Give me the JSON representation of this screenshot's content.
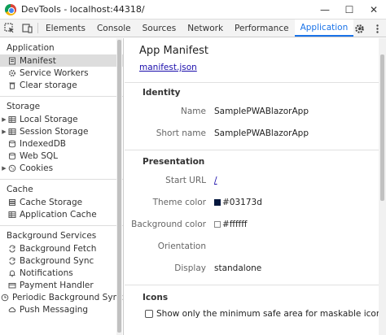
{
  "window": {
    "title": "DevTools - localhost:44318/",
    "controls": {
      "minimize": "—",
      "maximize": "☐",
      "close": "✕"
    }
  },
  "toolbar": {
    "tabs": [
      {
        "label": "Elements"
      },
      {
        "label": "Console"
      },
      {
        "label": "Sources"
      },
      {
        "label": "Network"
      },
      {
        "label": "Performance"
      },
      {
        "label": "Application"
      }
    ],
    "active_tab": "Application",
    "more_label": "»"
  },
  "sidebar": {
    "sections": {
      "application": "Application",
      "storage": "Storage",
      "cache": "Cache",
      "background_services": "Background Services"
    },
    "application_items": [
      {
        "label": "Manifest"
      },
      {
        "label": "Service Workers"
      },
      {
        "label": "Clear storage"
      }
    ],
    "storage_items": [
      {
        "label": "Local Storage"
      },
      {
        "label": "Session Storage"
      },
      {
        "label": "IndexedDB"
      },
      {
        "label": "Web SQL"
      },
      {
        "label": "Cookies"
      }
    ],
    "cache_items": [
      {
        "label": "Cache Storage"
      },
      {
        "label": "Application Cache"
      }
    ],
    "background_items": [
      {
        "label": "Background Fetch"
      },
      {
        "label": "Background Sync"
      },
      {
        "label": "Notifications"
      },
      {
        "label": "Payment Handler"
      },
      {
        "label": "Periodic Background Sync"
      },
      {
        "label": "Push Messaging"
      }
    ]
  },
  "main": {
    "title": "App Manifest",
    "manifest_link": "manifest.json",
    "identity": {
      "heading": "Identity",
      "name_label": "Name",
      "name_value": "SamplePWABlazorApp",
      "short_name_label": "Short name",
      "short_name_value": "SamplePWABlazorApp"
    },
    "presentation": {
      "heading": "Presentation",
      "start_url_label": "Start URL",
      "start_url_value": "/",
      "theme_color_label": "Theme color",
      "theme_color_value": "#03173d",
      "background_color_label": "Background color",
      "background_color_value": "#ffffff",
      "orientation_label": "Orientation",
      "orientation_value": "",
      "display_label": "Display",
      "display_value": "standalone"
    },
    "icons": {
      "heading": "Icons",
      "checkbox_label": "Show only the minimum safe area for maskable icons",
      "checked": false
    }
  },
  "colors": {
    "accent": "#1a73e8",
    "theme_swatch": "#03173d",
    "background_swatch": "#ffffff"
  }
}
